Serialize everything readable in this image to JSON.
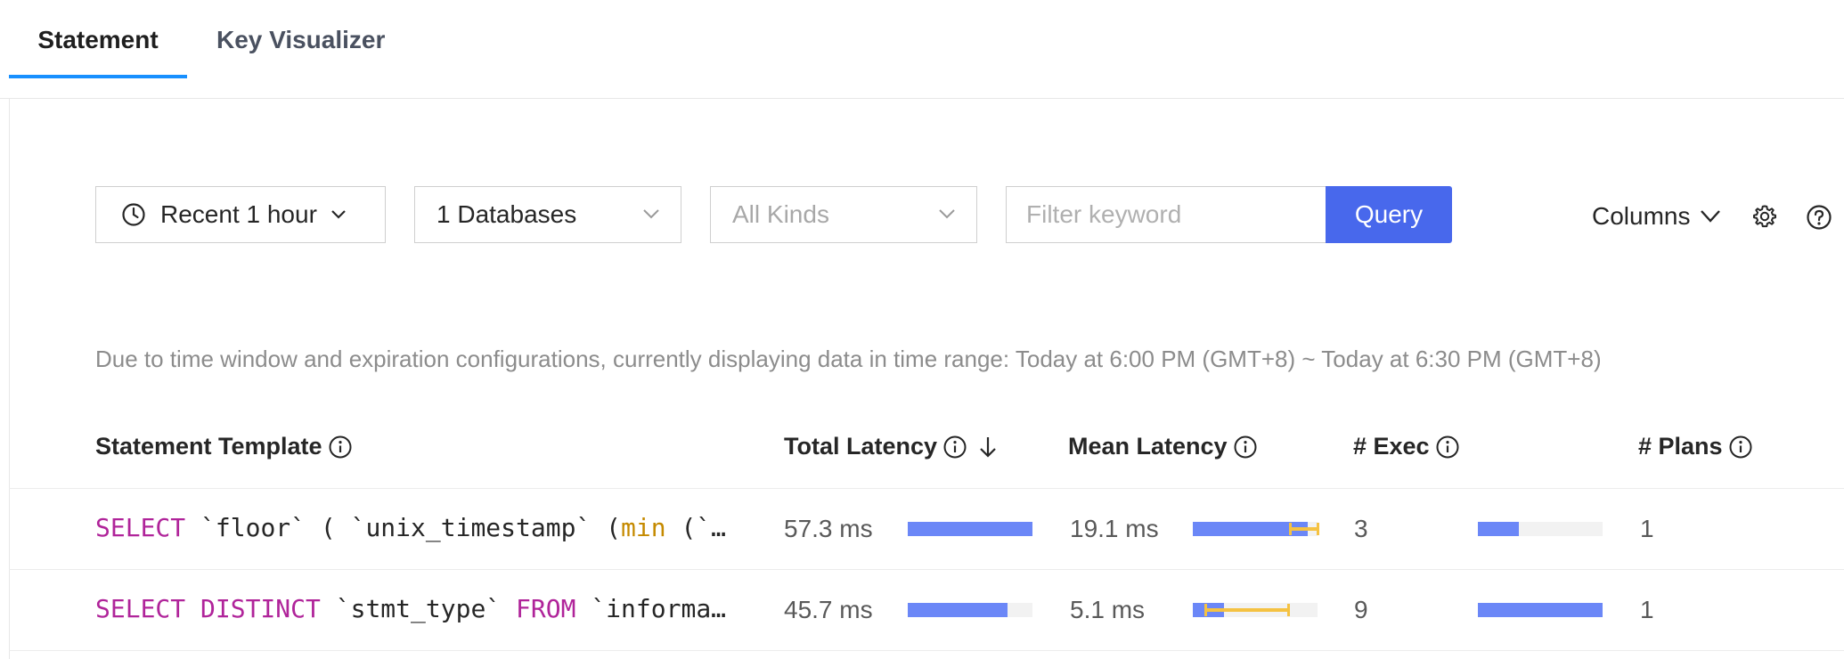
{
  "tabs": [
    {
      "label": "Statement",
      "active": true
    },
    {
      "label": "Key Visualizer",
      "active": false
    }
  ],
  "toolbar": {
    "time_range": "Recent 1 hour",
    "databases": "1 Databases",
    "kinds_placeholder": "All Kinds",
    "search_placeholder": "Filter keyword",
    "query_label": "Query",
    "columns_label": "Columns"
  },
  "notice": "Due to time window and expiration configurations, currently displaying data in time range: Today at 6:00 PM (GMT+8) ~ Today at 6:30 PM (GMT+8)",
  "table": {
    "headers": {
      "template": "Statement Template",
      "total_latency": "Total Latency",
      "mean_latency": "Mean Latency",
      "exec": "# Exec",
      "plans": "# Plans"
    },
    "rows": [
      {
        "sql_kw1": "SELECT",
        "sql_p1": " `floor` ( `unix_timestamp` (",
        "sql_fn": "min",
        "sql_p2": " (`…",
        "total_latency": "57.3 ms",
        "total_fraction": 1.0,
        "mean_latency": "19.1 ms",
        "mean_fraction": 0.92,
        "mean_err_low": 0.78,
        "mean_err_high": 1.0,
        "exec": "3",
        "exec_fraction": 0.33,
        "plans": "1"
      },
      {
        "sql_kw1": "SELECT DISTINCT",
        "sql_p1": " `stmt_type` ",
        "sql_kw2": "FROM",
        "sql_p2": " `informa…",
        "total_latency": "45.7 ms",
        "total_fraction": 0.8,
        "mean_latency": "5.1 ms",
        "mean_fraction": 0.25,
        "mean_err_low": 0.1,
        "mean_err_high": 0.77,
        "exec": "9",
        "exec_fraction": 1.0,
        "plans": "1"
      }
    ]
  },
  "colors": {
    "accent": "#1890ff",
    "query_button": "#4868ec",
    "bar": "#6b87f7",
    "error_bar": "#f5c242",
    "keyword": "#b0249a",
    "function": "#c58a00"
  },
  "icons": [
    "clock-icon",
    "chevron-down-icon",
    "gear-icon",
    "help-icon",
    "info-icon",
    "sort-desc-icon"
  ]
}
